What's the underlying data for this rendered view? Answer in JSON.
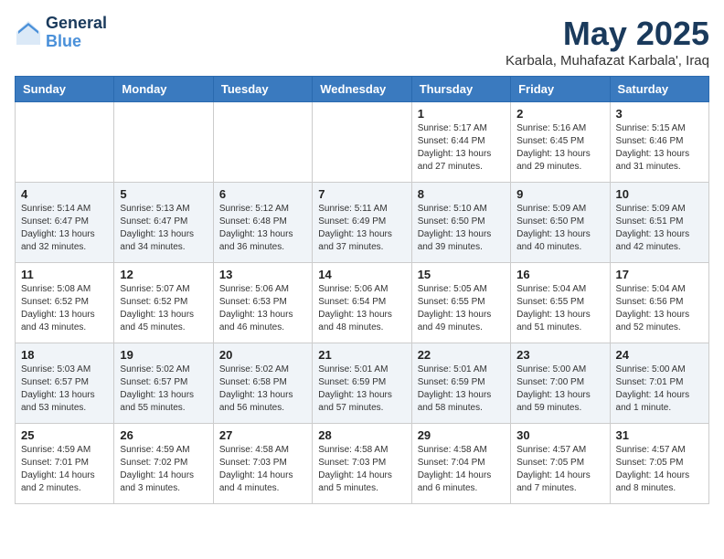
{
  "header": {
    "logo_general": "General",
    "logo_blue": "Blue",
    "month_title": "May 2025",
    "location": "Karbala, Muhafazat Karbala', Iraq"
  },
  "weekdays": [
    "Sunday",
    "Monday",
    "Tuesday",
    "Wednesday",
    "Thursday",
    "Friday",
    "Saturday"
  ],
  "weeks": [
    [
      {
        "day": "",
        "content": ""
      },
      {
        "day": "",
        "content": ""
      },
      {
        "day": "",
        "content": ""
      },
      {
        "day": "",
        "content": ""
      },
      {
        "day": "1",
        "content": "Sunrise: 5:17 AM\nSunset: 6:44 PM\nDaylight: 13 hours\nand 27 minutes."
      },
      {
        "day": "2",
        "content": "Sunrise: 5:16 AM\nSunset: 6:45 PM\nDaylight: 13 hours\nand 29 minutes."
      },
      {
        "day": "3",
        "content": "Sunrise: 5:15 AM\nSunset: 6:46 PM\nDaylight: 13 hours\nand 31 minutes."
      }
    ],
    [
      {
        "day": "4",
        "content": "Sunrise: 5:14 AM\nSunset: 6:47 PM\nDaylight: 13 hours\nand 32 minutes."
      },
      {
        "day": "5",
        "content": "Sunrise: 5:13 AM\nSunset: 6:47 PM\nDaylight: 13 hours\nand 34 minutes."
      },
      {
        "day": "6",
        "content": "Sunrise: 5:12 AM\nSunset: 6:48 PM\nDaylight: 13 hours\nand 36 minutes."
      },
      {
        "day": "7",
        "content": "Sunrise: 5:11 AM\nSunset: 6:49 PM\nDaylight: 13 hours\nand 37 minutes."
      },
      {
        "day": "8",
        "content": "Sunrise: 5:10 AM\nSunset: 6:50 PM\nDaylight: 13 hours\nand 39 minutes."
      },
      {
        "day": "9",
        "content": "Sunrise: 5:09 AM\nSunset: 6:50 PM\nDaylight: 13 hours\nand 40 minutes."
      },
      {
        "day": "10",
        "content": "Sunrise: 5:09 AM\nSunset: 6:51 PM\nDaylight: 13 hours\nand 42 minutes."
      }
    ],
    [
      {
        "day": "11",
        "content": "Sunrise: 5:08 AM\nSunset: 6:52 PM\nDaylight: 13 hours\nand 43 minutes."
      },
      {
        "day": "12",
        "content": "Sunrise: 5:07 AM\nSunset: 6:52 PM\nDaylight: 13 hours\nand 45 minutes."
      },
      {
        "day": "13",
        "content": "Sunrise: 5:06 AM\nSunset: 6:53 PM\nDaylight: 13 hours\nand 46 minutes."
      },
      {
        "day": "14",
        "content": "Sunrise: 5:06 AM\nSunset: 6:54 PM\nDaylight: 13 hours\nand 48 minutes."
      },
      {
        "day": "15",
        "content": "Sunrise: 5:05 AM\nSunset: 6:55 PM\nDaylight: 13 hours\nand 49 minutes."
      },
      {
        "day": "16",
        "content": "Sunrise: 5:04 AM\nSunset: 6:55 PM\nDaylight: 13 hours\nand 51 minutes."
      },
      {
        "day": "17",
        "content": "Sunrise: 5:04 AM\nSunset: 6:56 PM\nDaylight: 13 hours\nand 52 minutes."
      }
    ],
    [
      {
        "day": "18",
        "content": "Sunrise: 5:03 AM\nSunset: 6:57 PM\nDaylight: 13 hours\nand 53 minutes."
      },
      {
        "day": "19",
        "content": "Sunrise: 5:02 AM\nSunset: 6:57 PM\nDaylight: 13 hours\nand 55 minutes."
      },
      {
        "day": "20",
        "content": "Sunrise: 5:02 AM\nSunset: 6:58 PM\nDaylight: 13 hours\nand 56 minutes."
      },
      {
        "day": "21",
        "content": "Sunrise: 5:01 AM\nSunset: 6:59 PM\nDaylight: 13 hours\nand 57 minutes."
      },
      {
        "day": "22",
        "content": "Sunrise: 5:01 AM\nSunset: 6:59 PM\nDaylight: 13 hours\nand 58 minutes."
      },
      {
        "day": "23",
        "content": "Sunrise: 5:00 AM\nSunset: 7:00 PM\nDaylight: 13 hours\nand 59 minutes."
      },
      {
        "day": "24",
        "content": "Sunrise: 5:00 AM\nSunset: 7:01 PM\nDaylight: 14 hours\nand 1 minute."
      }
    ],
    [
      {
        "day": "25",
        "content": "Sunrise: 4:59 AM\nSunset: 7:01 PM\nDaylight: 14 hours\nand 2 minutes."
      },
      {
        "day": "26",
        "content": "Sunrise: 4:59 AM\nSunset: 7:02 PM\nDaylight: 14 hours\nand 3 minutes."
      },
      {
        "day": "27",
        "content": "Sunrise: 4:58 AM\nSunset: 7:03 PM\nDaylight: 14 hours\nand 4 minutes."
      },
      {
        "day": "28",
        "content": "Sunrise: 4:58 AM\nSunset: 7:03 PM\nDaylight: 14 hours\nand 5 minutes."
      },
      {
        "day": "29",
        "content": "Sunrise: 4:58 AM\nSunset: 7:04 PM\nDaylight: 14 hours\nand 6 minutes."
      },
      {
        "day": "30",
        "content": "Sunrise: 4:57 AM\nSunset: 7:05 PM\nDaylight: 14 hours\nand 7 minutes."
      },
      {
        "day": "31",
        "content": "Sunrise: 4:57 AM\nSunset: 7:05 PM\nDaylight: 14 hours\nand 8 minutes."
      }
    ]
  ]
}
